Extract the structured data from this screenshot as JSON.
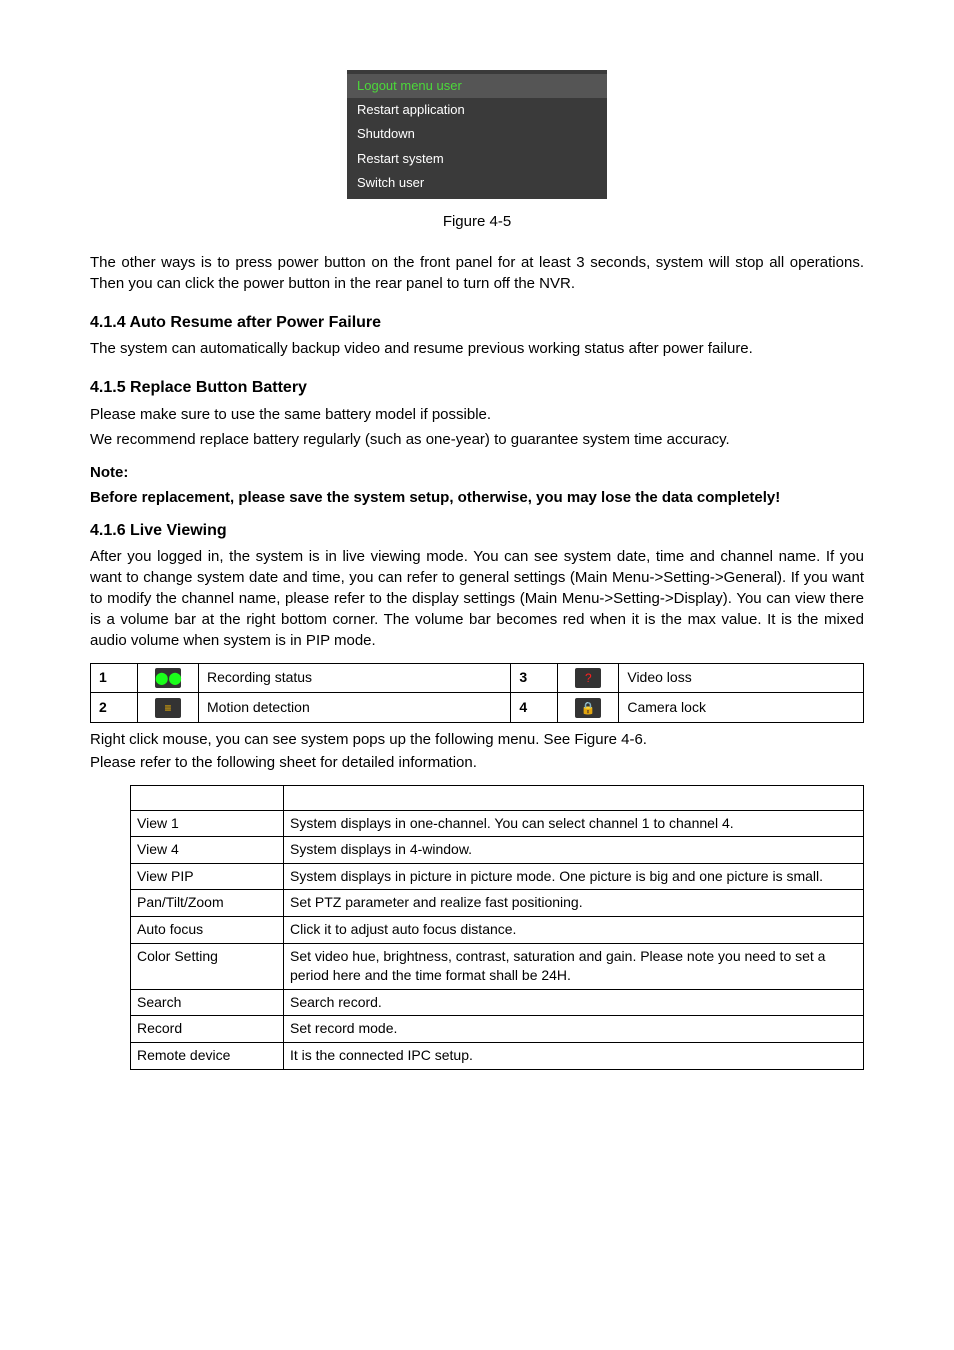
{
  "menu": {
    "items": [
      "Logout menu user",
      "Restart application",
      "Shutdown",
      "Restart system",
      "Switch user"
    ]
  },
  "figure_caption": "Figure 4-5",
  "para1": "The other ways is to press power button on the front panel for at least 3 seconds, system will stop all operations. Then you can click the power button in the rear panel to turn off the NVR.",
  "sec_414_title": "4.1.4   Auto Resume after Power Failure",
  "sec_414_body": "The system can automatically backup video and resume previous working status after power failure.",
  "sec_415_title": "4.1.5  Replace Button Battery",
  "sec_415_p1": "Please make sure to use the same battery model if possible.",
  "sec_415_p2": "We recommend replace battery regularly (such as one-year) to guarantee system time accuracy.",
  "note_label": "Note:",
  "sec_415_note": "Before replacement, please save the system setup, otherwise, you may lose the data completely!",
  "sec_416_title": "4.1.6  Live Viewing",
  "sec_416_body": "After you logged in, the system is in live viewing mode. You can see system date, time and channel name. If you want to change system date and time, you can refer to general settings (Main Menu->Setting->General). If you want to modify the channel name, please refer to the display settings (Main Menu->Setting->Display). You can view there is a volume bar at the right bottom corner. The volume bar becomes red when it is the max value.  It is the mixed audio volume when system is in PIP mode.",
  "status_rows": [
    {
      "n": "1",
      "desc1": "Recording status",
      "n2": "3",
      "desc2": "Video loss"
    },
    {
      "n": "2",
      "desc1": "Motion detection",
      "n2": "4",
      "desc2": "Camera lock"
    }
  ],
  "after_status_p1": "Right click mouse, you can see system pops up the following menu. See Figure 4-6.",
  "after_status_p2": "Please refer to the following sheet for detailed information.",
  "info_rows": [
    {
      "label": "View 1",
      "value": "System displays in one-channel. You can select channel 1 to channel 4."
    },
    {
      "label": "View 4",
      "value": "System displays in 4-window."
    },
    {
      "label": "View PIP",
      "value": "System displays in picture in picture mode. One picture is big and one picture is small."
    },
    {
      "label": "Pan/Tilt/Zoom",
      "value": "Set PTZ parameter and realize fast positioning."
    },
    {
      "label": "Auto focus",
      "value": "Click it to adjust auto focus distance."
    },
    {
      "label": "Color Setting",
      "value": "Set video hue, brightness, contrast, saturation and gain. Please note you need to set a period here and the time format shall be 24H."
    },
    {
      "label": "Search",
      "value": "Search record."
    },
    {
      "label": "Record",
      "value": "Set record mode."
    },
    {
      "label": "Remote device",
      "value": "It is the connected IPC setup."
    }
  ]
}
